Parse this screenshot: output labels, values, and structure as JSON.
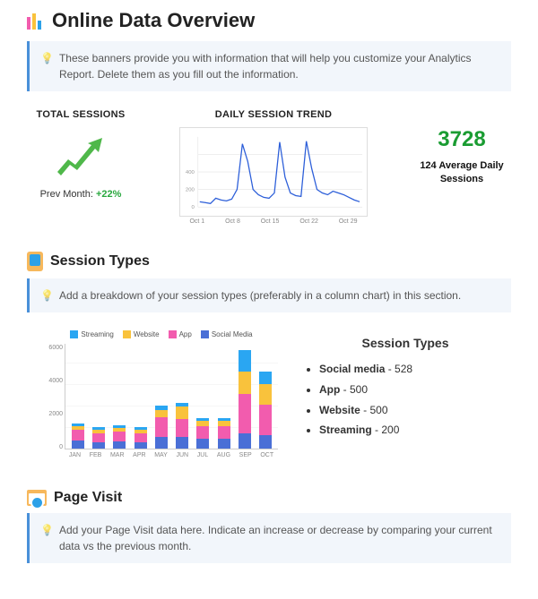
{
  "title": "Online Data Overview",
  "banner1": "These banners provide you with information that will help you customize your Analytics Report. Delete them as you fill out the information.",
  "sessions": {
    "heading": "TOTAL SESSIONS",
    "prev_label": "Prev Month: ",
    "prev_value": "+22%"
  },
  "trend": {
    "heading": "DAILY SESSION TREND",
    "ticks": [
      "Oct 1",
      "Oct 8",
      "Oct 15",
      "Oct 22",
      "Oct 29"
    ]
  },
  "metric": {
    "value": "3728",
    "caption": "124 Average Daily Sessions"
  },
  "session_types": {
    "title": "Session Types",
    "banner": "Add a breakdown of your session types (preferably in a column chart) in this section.",
    "list_title": "Session Types",
    "items": [
      {
        "label": "Social media",
        "value": "528"
      },
      {
        "label": "App",
        "value": "500"
      },
      {
        "label": "Website",
        "value": "500"
      },
      {
        "label": "Streaming",
        "value": "200"
      }
    ]
  },
  "page_visit": {
    "title": "Page Visit",
    "banner": "Add your Page Visit data here. Indicate an increase or decrease by comparing your current data vs the previous month."
  },
  "chart_data": [
    {
      "type": "line",
      "title": "DAILY SESSION TREND",
      "x_ticks": [
        "Oct 1",
        "Oct 8",
        "Oct 15",
        "Oct 22",
        "Oct 29"
      ],
      "ylim": [
        0,
        500
      ],
      "values": [
        40,
        35,
        30,
        60,
        50,
        45,
        55,
        120,
        420,
        300,
        120,
        90,
        70,
        60,
        100,
        430,
        210,
        100,
        80,
        75,
        440,
        260,
        120,
        100,
        90,
        110,
        100,
        90,
        70,
        50,
        40
      ]
    },
    {
      "type": "bar",
      "title": "Session Types",
      "stacked": true,
      "categories": [
        "JAN",
        "FEB",
        "MAR",
        "APR",
        "MAY",
        "JUN",
        "JUL",
        "AUG",
        "SEP",
        "OCT"
      ],
      "ylim": [
        0,
        6000
      ],
      "series": [
        {
          "name": "Social Media",
          "color": "#4a6fd6",
          "values": [
            500,
            400,
            450,
            400,
            700,
            700,
            600,
            600,
            900,
            800
          ]
        },
        {
          "name": "App",
          "color": "#f25cae",
          "values": [
            600,
            500,
            550,
            500,
            1100,
            1000,
            700,
            700,
            2200,
            1700
          ]
        },
        {
          "name": "Website",
          "color": "#f9c23c",
          "values": [
            200,
            200,
            200,
            200,
            400,
            700,
            300,
            300,
            1300,
            1200
          ]
        },
        {
          "name": "Streaming",
          "color": "#2aa6f2",
          "values": [
            150,
            150,
            150,
            150,
            250,
            200,
            150,
            150,
            1200,
            700
          ]
        }
      ],
      "legend": [
        "Streaming",
        "Website",
        "App",
        "Social Media"
      ]
    }
  ]
}
